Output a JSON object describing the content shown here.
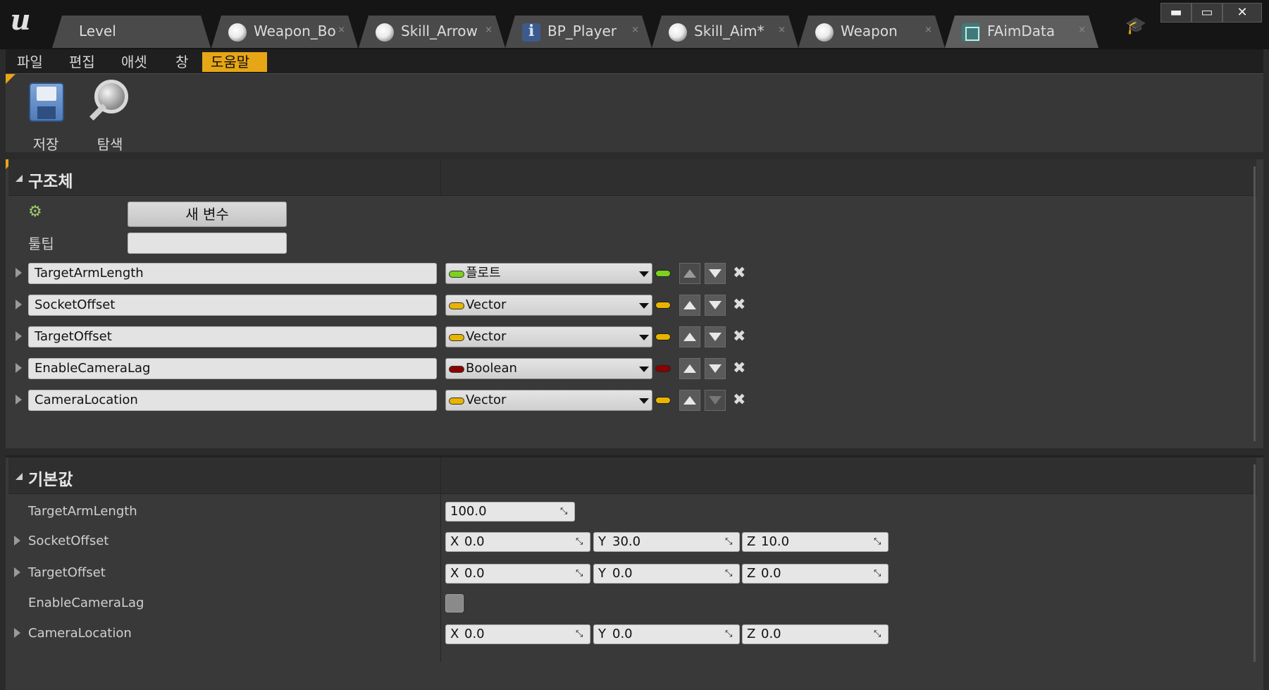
{
  "tabs": [
    {
      "label": "Level",
      "icon": "none",
      "close": ""
    },
    {
      "label": "Weapon_Bow",
      "icon": "sphere-icon",
      "close": "×"
    },
    {
      "label": "Skill_Arrow",
      "icon": "sphere-icon",
      "close": "×"
    },
    {
      "label": "BP_Player",
      "icon": "blueprint-icon",
      "close": "×"
    },
    {
      "label": "Skill_Aim*",
      "icon": "sphere-icon",
      "close": "×"
    },
    {
      "label": "Weapon",
      "icon": "sphere-icon",
      "close": "×"
    },
    {
      "label": "FAimData",
      "icon": "struct-icon",
      "close": "×"
    }
  ],
  "window_buttons": {
    "minimize": "▬",
    "maximize": "▭",
    "close": "✕"
  },
  "menu": [
    "파일",
    "편집",
    "애셋",
    "창",
    "도움말"
  ],
  "toolbar": {
    "save_label": "저장",
    "browse_label": "탐색"
  },
  "structure": {
    "title": "구조체",
    "new_var_label": "새 변수",
    "tooltip_label": "툴팁",
    "tooltip_value": "",
    "variables": [
      {
        "name": "TargetArmLength",
        "type": "플로트",
        "color": "#7bd11c"
      },
      {
        "name": "SocketOffset",
        "type": "Vector",
        "color": "#e8b400"
      },
      {
        "name": "TargetOffset",
        "type": "Vector",
        "color": "#e8b400"
      },
      {
        "name": "EnableCameraLag",
        "type": "Boolean",
        "color": "#8c0000"
      },
      {
        "name": "CameraLocation",
        "type": "Vector",
        "color": "#e8b400"
      }
    ]
  },
  "defaults": {
    "title": "기본값",
    "target_arm_length": {
      "label": "TargetArmLength",
      "value": "100.0"
    },
    "socket_offset": {
      "label": "SocketOffset",
      "x": "0.0",
      "y": "30.0",
      "z": "10.0"
    },
    "target_offset": {
      "label": "TargetOffset",
      "x": "0.0",
      "y": "0.0",
      "z": "0.0"
    },
    "enable_camera_lag": {
      "label": "EnableCameraLag",
      "checked": false
    },
    "camera_location": {
      "label": "CameraLocation",
      "x": "0.0",
      "y": "0.0",
      "z": "0.0"
    },
    "axis": {
      "x": "X",
      "y": "Y",
      "z": "Z"
    }
  },
  "colors": {
    "accent": "#e6a615"
  }
}
